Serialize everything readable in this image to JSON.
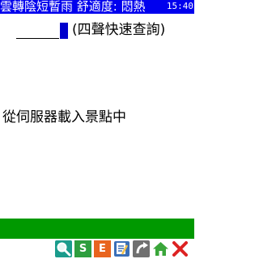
{
  "header": {
    "weather_text": "雲轉陰短暫雨 舒適度: 悶熱",
    "clock": "15:40"
  },
  "search": {
    "value": "",
    "hint": "(四聲快速查詢)"
  },
  "main": {
    "status_text": "從伺服器載入景點中"
  },
  "toolbar": {
    "items": [
      {
        "icon": "magnifier-icon",
        "color": "#1a9c8c"
      },
      {
        "icon": "letter-s-icon",
        "label": "S",
        "color": "#2e9e3e"
      },
      {
        "icon": "letter-e-icon",
        "label": "E",
        "color": "#e8641e"
      },
      {
        "icon": "document-edit-icon",
        "color": "#3a6fb8"
      },
      {
        "icon": "back-arrow-icon",
        "color": "#707070"
      },
      {
        "icon": "home-icon",
        "color": "#3aa63a"
      },
      {
        "icon": "close-x-icon",
        "color": "#dd2222"
      }
    ]
  },
  "colors": {
    "header_bg": "#0000ee",
    "caret": "#0000cc",
    "bottom_bar": "#009900"
  }
}
